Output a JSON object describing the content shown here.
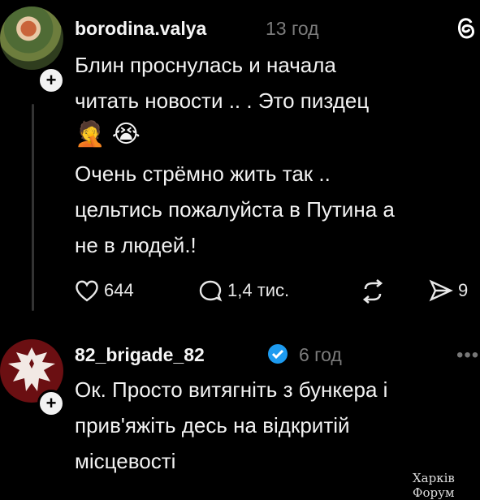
{
  "posts": [
    {
      "username": "borodina.valya",
      "time": "13 год",
      "text1": "Блин проснулась и начала\nчитать новости .. . Это пиздец",
      "emojis": "🤦 😭",
      "text2": "Очень стрёмно жить так ..\nцельтись пожалуйста в Путина а\nне в людей.!",
      "likes": "644",
      "comments": "1,4 тис.",
      "shares": "9"
    },
    {
      "username": "82_brigade_82",
      "time": "6 год",
      "text": "Ок. Просто витягніть з бункера і\nприв'яжіть десь на відкритій\nмісцевості"
    }
  ],
  "watermark": "Харків Форум",
  "icons": [
    "plus-icon",
    "threads-logo-icon",
    "heart-icon",
    "comment-icon",
    "repost-icon",
    "share-icon",
    "verified-icon",
    "more-icon"
  ]
}
